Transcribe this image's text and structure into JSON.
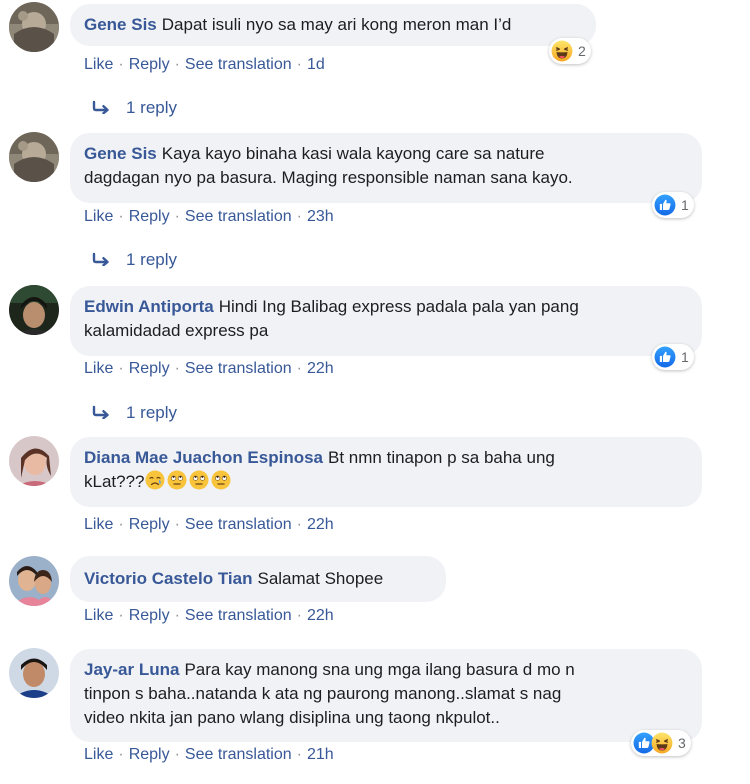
{
  "actions": {
    "like": "Like",
    "reply": "Reply",
    "translate": "See translation",
    "sep": "·"
  },
  "comments": [
    {
      "author": "Gene Sis",
      "text": "Dapat isuli nyo sa may ari kong meron man I’d",
      "time": "1d",
      "reactions": {
        "icons": [
          "haha-icon"
        ],
        "count": "2"
      },
      "replies": "1 reply"
    },
    {
      "author": "Gene Sis",
      "text_lines": [
        "Kaya kayo binaha kasi wala kayong care sa nature",
        "dagdagan nyo pa basura. Maging responsible naman sana kayo."
      ],
      "time": "23h",
      "reactions": {
        "icons": [
          "like-icon"
        ],
        "count": "1"
      },
      "replies": "1 reply"
    },
    {
      "author": "Edwin Antiporta",
      "text_lines": [
        "Hindi Ing Balibag express padala pala yan pang",
        "kalamidadad express pa"
      ],
      "time": "22h",
      "reactions": {
        "icons": [
          "like-icon"
        ],
        "count": "1"
      },
      "replies": "1 reply"
    },
    {
      "author": "Diana Mae Juachon Espinosa",
      "text_lines": [
        "Bt nmn tinapon p sa baha ung",
        "kLat???"
      ],
      "emojis": [
        "sad-tear-emoji",
        "rolling-eyes-emoji",
        "rolling-eyes-emoji",
        "rolling-eyes-emoji"
      ],
      "time": "22h"
    },
    {
      "author": "Victorio Castelo Tian",
      "text": "Salamat Shopee",
      "time": "22h"
    },
    {
      "author": "Jay-ar Luna",
      "text_lines": [
        "Para kay manong sna ung mga ilang basura d mo n",
        "tinpon s baha..natanda k ata ng paurong manong..slamat s nag",
        "video nkita jan pano wlang disiplina ung taong nkpulot.."
      ],
      "time": "21h",
      "reactions": {
        "icons": [
          "like-icon",
          "haha-icon"
        ],
        "count": "3"
      }
    }
  ],
  "colors": {
    "author": "#385898",
    "bubble": "#f0f2f5",
    "like_blue": "#1877f2",
    "haha_yellow": "#f7b125"
  }
}
